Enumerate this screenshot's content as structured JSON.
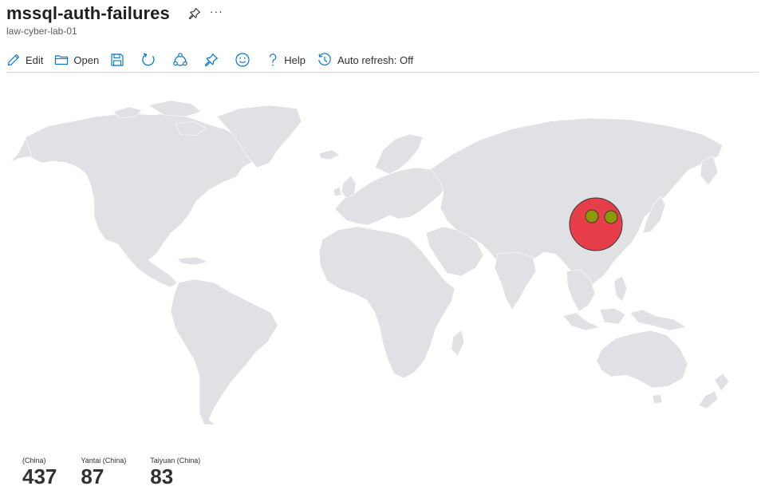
{
  "header": {
    "title": "mssql-auth-failures",
    "subtitle": "law-cyber-lab-01",
    "more_label": "···"
  },
  "toolbar": {
    "edit_label": "Edit",
    "open_label": "Open",
    "help_label": "Help",
    "auto_refresh_label": "Auto refresh: Off"
  },
  "map": {
    "land_color": "#dfe1e5",
    "markers": [
      {
        "name": "(China)",
        "color": "#e83e4a",
        "size": "large"
      },
      {
        "name": "Yantai (China)",
        "color": "#8a9a00",
        "size": "small"
      },
      {
        "name": "Taiyuan (China)",
        "color": "#8a9a00",
        "size": "small"
      }
    ]
  },
  "stats": [
    {
      "label": "(China)",
      "value": "437"
    },
    {
      "label": "Yantai (China)",
      "value": "87"
    },
    {
      "label": "Taiyuan (China)",
      "value": "83"
    }
  ],
  "colors": {
    "accent": "#0078d4",
    "title_text": "#201f1e",
    "marker_primary": "#e83e4a",
    "marker_secondary": "#8a9a00"
  }
}
